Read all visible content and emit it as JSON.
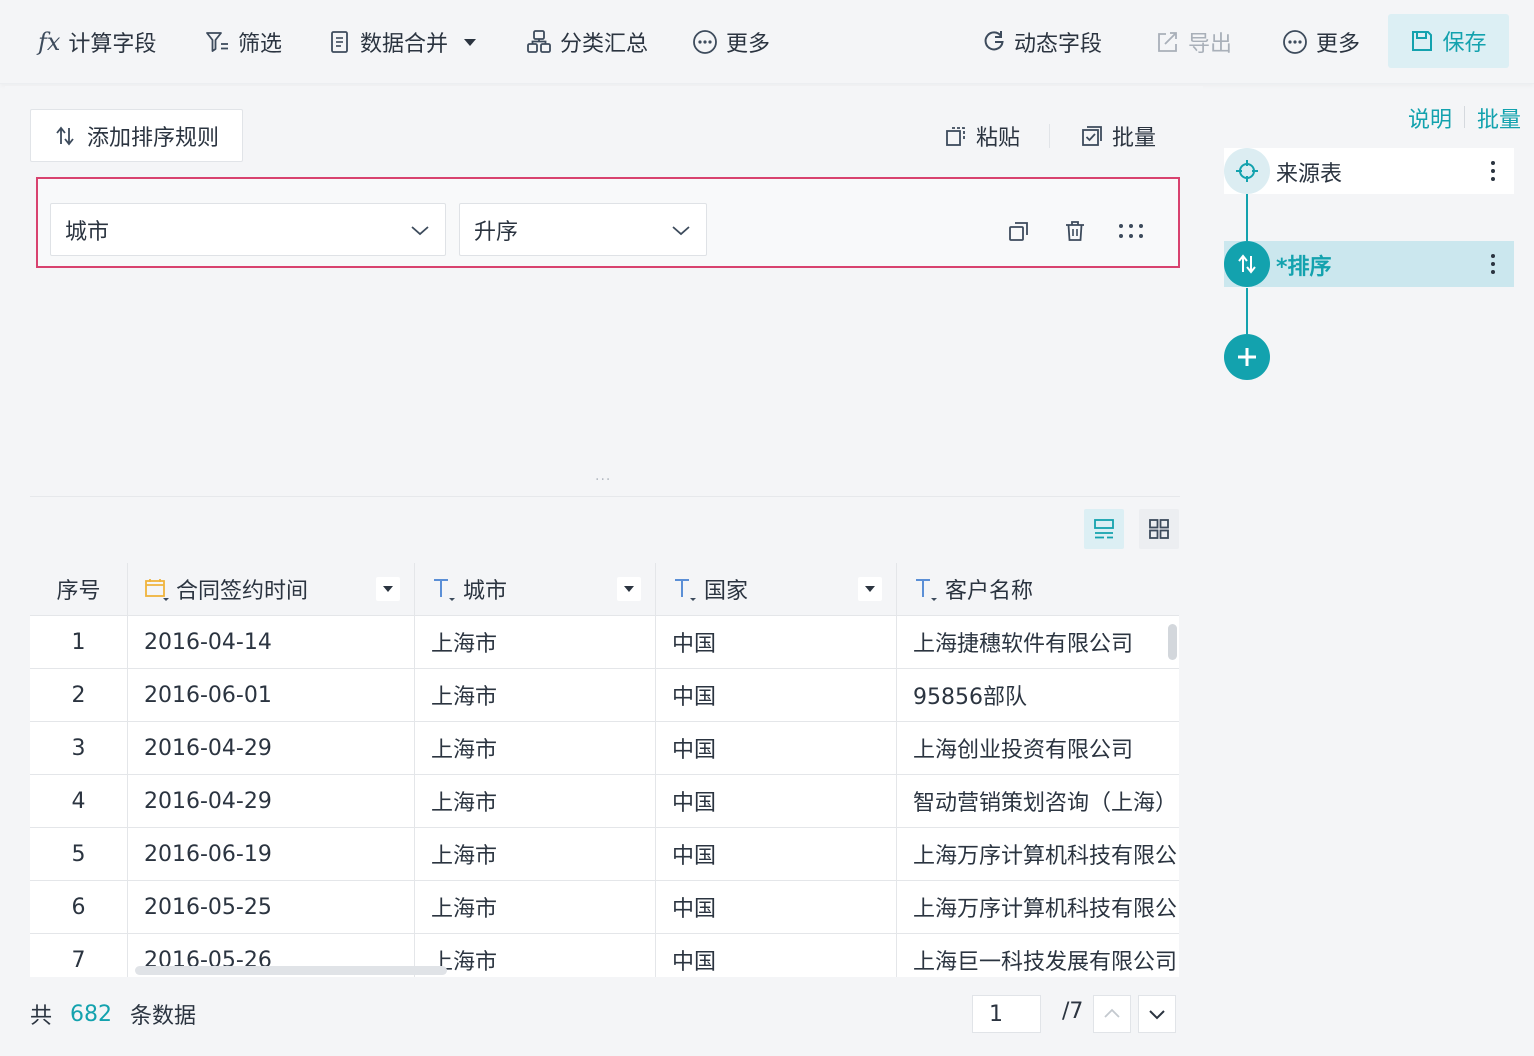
{
  "toolbar": {
    "fx_glyph": "fx",
    "calc_field": "计算字段",
    "filter": "筛选",
    "data_merge": "数据合并",
    "group_summary": "分类汇总",
    "more_left": "更多",
    "dynamic_field": "动态字段",
    "export": "导出",
    "more_right": "更多",
    "save": "保存"
  },
  "sort_panel": {
    "add_rule": "添加排序规则",
    "paste": "粘贴",
    "batch": "批量",
    "rule": {
      "field": "城市",
      "order": "升序"
    }
  },
  "splitter": "···",
  "table": {
    "columns": [
      {
        "label": "序号",
        "type": "seq"
      },
      {
        "label": "合同签约时间",
        "type": "date"
      },
      {
        "label": "城市",
        "type": "text"
      },
      {
        "label": "国家",
        "type": "text"
      },
      {
        "label": "客户名称",
        "type": "text"
      }
    ],
    "rows": [
      [
        "1",
        "2016-04-14",
        "上海市",
        "中国",
        "上海捷穗软件有限公司"
      ],
      [
        "2",
        "2016-06-01",
        "上海市",
        "中国",
        "95856部队"
      ],
      [
        "3",
        "2016-04-29",
        "上海市",
        "中国",
        "上海创业投资有限公司"
      ],
      [
        "4",
        "2016-04-29",
        "上海市",
        "中国",
        "智动营销策划咨询（上海）"
      ],
      [
        "5",
        "2016-06-19",
        "上海市",
        "中国",
        "上海万序计算机科技有限公"
      ],
      [
        "6",
        "2016-05-25",
        "上海市",
        "中国",
        "上海万序计算机科技有限公"
      ],
      [
        "7",
        "2016-05-26",
        "上海市",
        "中国",
        "上海巨一科技发展有限公司"
      ]
    ]
  },
  "footer": {
    "prefix": "共",
    "count": "682",
    "suffix": "条数据",
    "page_value": "1",
    "page_total": "/7"
  },
  "right_panel": {
    "explain": "说明",
    "batch": "批量",
    "nodes": [
      {
        "label": "来源表"
      },
      {
        "label": "*排序"
      }
    ]
  },
  "colors": {
    "accent": "#13a2ae",
    "highlight_border": "#d8426f",
    "selected_node_bg": "#cbe7ee",
    "date_icon": "#f0b43c",
    "text_type_icon": "#5b8fd6"
  }
}
